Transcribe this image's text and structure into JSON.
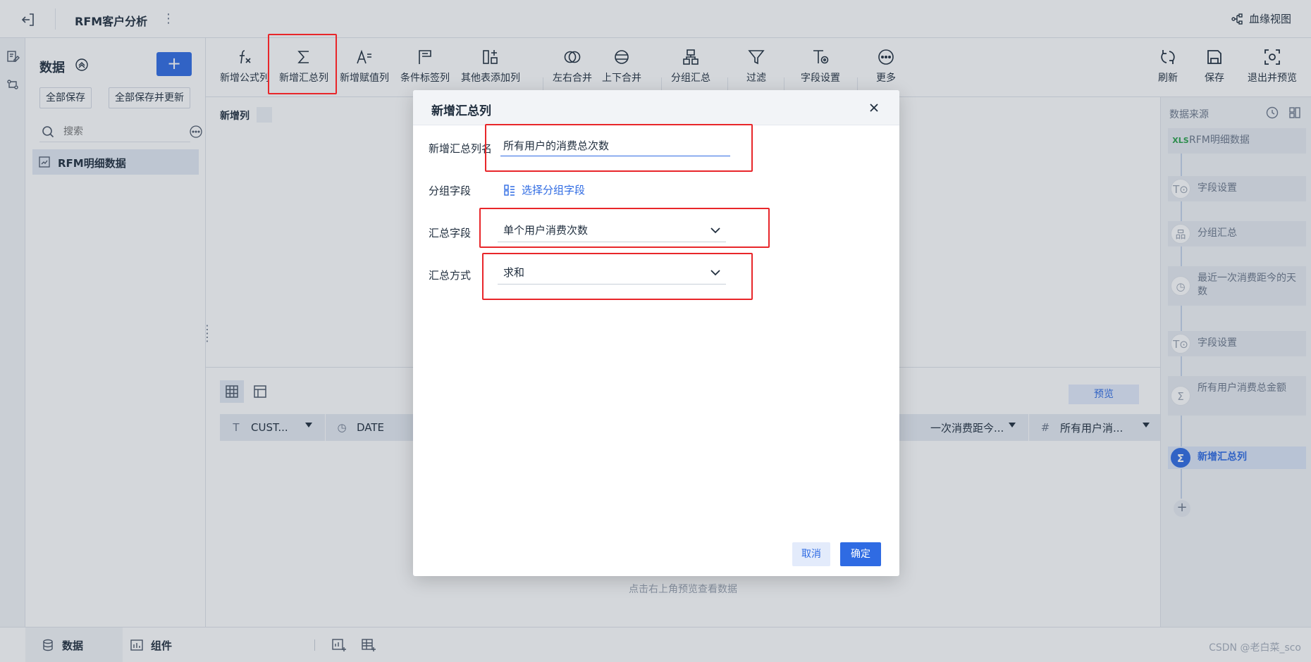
{
  "topbar": {
    "title": "RFM客户分析",
    "lineage_label": "血缘视图"
  },
  "left_panel": {
    "title": "数据",
    "add_label": "+",
    "save_all": "全部保存",
    "save_all_update": "全部保存并更新",
    "search_placeholder": "搜索",
    "items": [
      {
        "label": "RFM明细数据"
      }
    ]
  },
  "toolbar": {
    "items": [
      {
        "label": "新增公式列",
        "icon": "formula-icon"
      },
      {
        "label": "新增汇总列",
        "icon": "sigma-icon"
      },
      {
        "label": "新增赋值列",
        "icon": "assign-icon"
      },
      {
        "label": "条件标签列",
        "icon": "flag-icon"
      },
      {
        "label": "其他表添加列",
        "icon": "add-column-icon"
      },
      {
        "label": "左右合并",
        "icon": "merge-horizontal-icon"
      },
      {
        "label": "上下合并",
        "icon": "merge-vertical-icon"
      },
      {
        "label": "分组汇总",
        "icon": "group-icon"
      },
      {
        "label": "过滤",
        "icon": "filter-icon"
      },
      {
        "label": "字段设置",
        "icon": "field-settings-icon"
      },
      {
        "label": "更多",
        "icon": "more-icon"
      }
    ],
    "right_items": [
      {
        "label": "刷新",
        "icon": "refresh-icon"
      },
      {
        "label": "保存",
        "icon": "save-icon"
      },
      {
        "label": "退出并预览",
        "icon": "exit-preview-icon"
      }
    ]
  },
  "canvas": {
    "node_label": "新增列"
  },
  "preview": {
    "preview_button": "预览",
    "columns": [
      {
        "icon": "T",
        "label": "CUST..."
      },
      {
        "icon": "◷",
        "label": "DATE"
      },
      {
        "icon": "",
        "label": "一次消费距今..."
      },
      {
        "icon": "#",
        "label": "所有用户消..."
      }
    ],
    "empty_hint": "点击右上角预览查看数据"
  },
  "right_panel": {
    "title": "数据来源",
    "steps": [
      {
        "label": "RFM明细数据",
        "icon": "XLS"
      },
      {
        "label": "字段设置",
        "icon": "T⊙"
      },
      {
        "label": "分组汇总",
        "icon": "品"
      },
      {
        "label": "最近一次消费距今的天数",
        "icon": "◷"
      },
      {
        "label": "字段设置",
        "icon": "T⊙"
      },
      {
        "label": "所有用户消费总金额",
        "icon": "Σ"
      },
      {
        "label": "新增汇总列",
        "icon": "Σ"
      }
    ],
    "add_label": "+"
  },
  "bottombar": {
    "tabs": [
      {
        "label": "数据"
      },
      {
        "label": "组件"
      }
    ],
    "watermark": "CSDN @老白菜_sco"
  },
  "dialog": {
    "title": "新增汇总列",
    "name_label": "新增汇总列名",
    "name_value": "所有用户的消费总次数",
    "group_label": "分组字段",
    "group_link": "选择分组字段",
    "agg_field_label": "汇总字段",
    "agg_field_value": "单个用户消费次数",
    "agg_method_label": "汇总方式",
    "agg_method_value": "求和",
    "cancel": "取消",
    "confirm": "确定"
  },
  "colors": {
    "primary": "#2f6be3",
    "highlight": "#e8262a",
    "overlay": "rgba(60,72,92,0.22)"
  }
}
